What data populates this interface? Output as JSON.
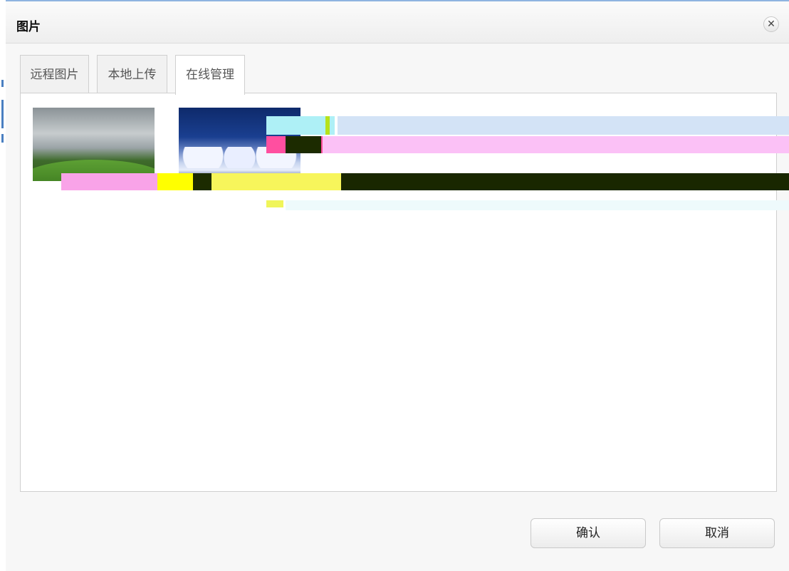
{
  "dialog": {
    "title": "图片",
    "close_icon": "close-icon"
  },
  "tabs": [
    {
      "label": "远程图片",
      "active": false
    },
    {
      "label": "本地上传",
      "active": false
    },
    {
      "label": "在线管理",
      "active": true
    }
  ],
  "images": [
    {
      "name": "landscape-hills"
    },
    {
      "name": "snowy-trees-night"
    }
  ],
  "buttons": {
    "confirm": "确认",
    "cancel": "取消"
  },
  "colors": {
    "dialog_bg": "#f7f7f7",
    "panel_border": "#cfcfcf",
    "accent_top": "#8fb4e0"
  }
}
